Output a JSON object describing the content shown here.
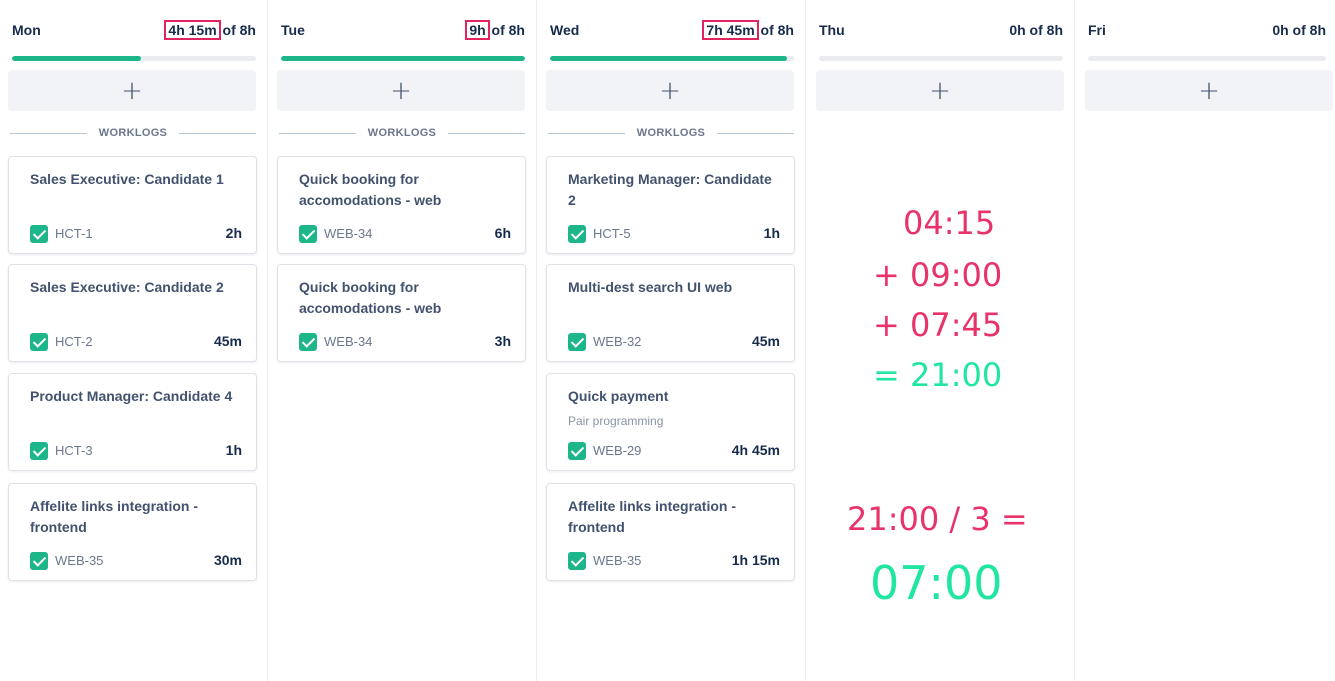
{
  "colors": {
    "accent_green": "#1db58a",
    "highlight_pink": "#e0245e",
    "calc_pink": "#e8336a",
    "calc_green": "#21e6a0"
  },
  "icons": {
    "add": "plus-icon",
    "task": "checkbox-icon"
  },
  "add_label": "+",
  "divider_label": "WORKLOGS",
  "days": [
    {
      "day": "Mon",
      "logged": "4h 15m",
      "target": " of 8h",
      "progress": 0.53,
      "worklogs": [
        {
          "title": "Sales Executive: Candidate 1",
          "key": "HCT-1",
          "duration": "2h"
        },
        {
          "title": "Sales Executive: Candidate 2",
          "key": "HCT-2",
          "duration": "45m"
        },
        {
          "title": "Product Manager: Candidate 4",
          "key": "HCT-3",
          "duration": "1h"
        },
        {
          "title": "Affelite links integration - frontend",
          "key": "WEB-35",
          "duration": "30m"
        }
      ]
    },
    {
      "day": "Tue",
      "logged": "9h",
      "target": " of 8h",
      "progress": 1.0,
      "worklogs": [
        {
          "title": "Quick booking for accomodations - web",
          "key": "WEB-34",
          "duration": "6h"
        },
        {
          "title": "Quick booking for accomodations - web",
          "key": "WEB-34",
          "duration": "3h"
        }
      ]
    },
    {
      "day": "Wed",
      "logged": "7h 45m",
      "target": " of 8h",
      "progress": 0.97,
      "worklogs": [
        {
          "title": "Marketing Manager: Candidate 2",
          "key": "HCT-5",
          "duration": "1h"
        },
        {
          "title": "Multi-dest search UI web",
          "key": "WEB-32",
          "duration": "45m"
        },
        {
          "title": "Quick payment",
          "subtitle": "Pair programming",
          "key": "WEB-29",
          "duration": "4h 45m"
        },
        {
          "title": "Affelite links integration - frontend",
          "key": "WEB-35",
          "duration": "1h 15m"
        }
      ]
    },
    {
      "day": "Thu",
      "logged": "0h of 8h",
      "target": "",
      "progress": 0,
      "worklogs": []
    },
    {
      "day": "Fri",
      "logged": "0h of 8h",
      "target": "",
      "progress": 0,
      "worklogs": []
    }
  ],
  "calc": {
    "line1": "04:15",
    "line2": "+ 09:00",
    "line3": "+ 07:45",
    "line4": "= 21:00",
    "line5": "21:00 / 3 =",
    "line6": "07:00"
  }
}
